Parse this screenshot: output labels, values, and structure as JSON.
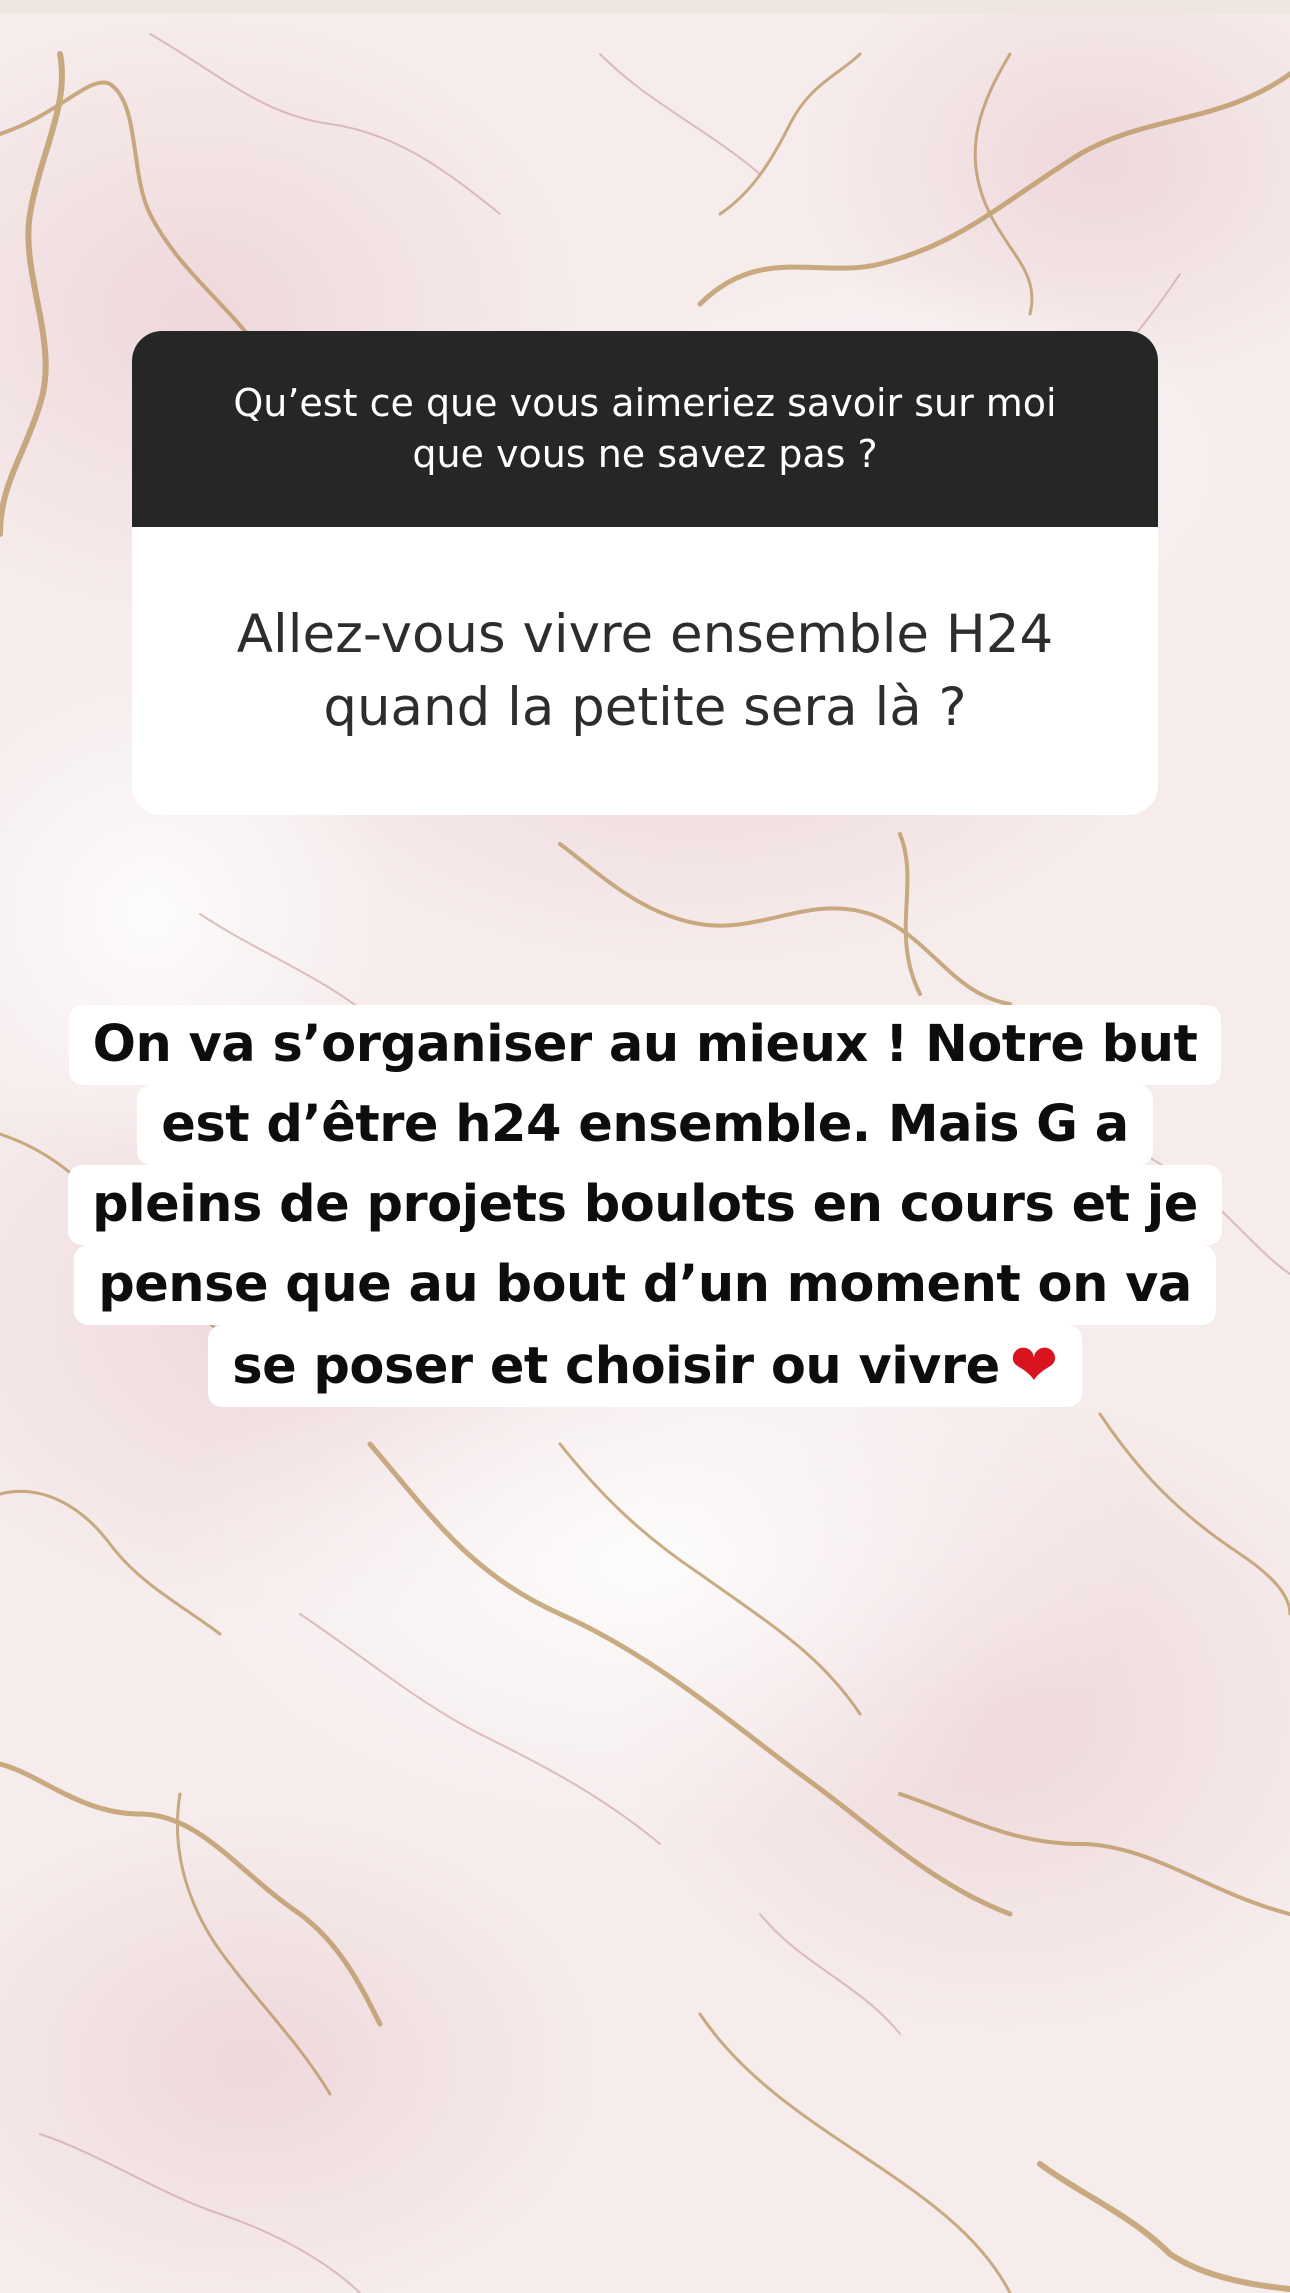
{
  "story": {
    "question_sticker": {
      "prompt": "Qu’est ce que vous aimeriez savoir sur moi que vous ne savez pas ?",
      "answer": "Allez-vous vivre ensemble H24 quand la petite sera là ?"
    },
    "reply": {
      "lines": [
        "On va s’organiser au mieux ! Notre but",
        "est d’être h24 ensemble. Mais G a",
        "pleins de projets boulots en cours et je",
        "pense que au bout d’un moment on va",
        "se poser et choisir ou vivre"
      ],
      "emoji_icon": "red-heart-icon",
      "emoji_glyph": "❤"
    },
    "colors": {
      "header_bg": "#262626",
      "card_bg": "#ffffff",
      "marble_base": "#f6ecec",
      "vein_gold": "#b8935c",
      "vein_pink": "#c99aa2"
    }
  }
}
